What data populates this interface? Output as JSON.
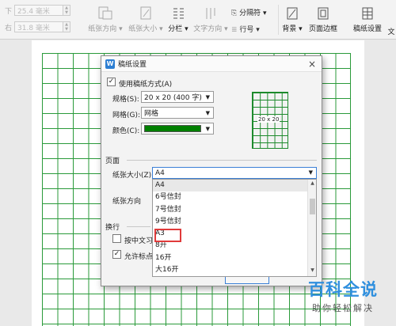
{
  "ribbon": {
    "spin1": {
      "label": "下",
      "value": "25.4 毫米"
    },
    "spin2": {
      "label": "右",
      "value": "31.8 毫米"
    },
    "buttons": [
      {
        "label": "纸张方向 ▾",
        "icon": "page-orientation-icon",
        "enabled": false
      },
      {
        "label": "纸张大小 ▾",
        "icon": "paper-size-icon",
        "enabled": false
      },
      {
        "label": "分栏 ▾",
        "icon": "columns-icon",
        "enabled": true
      },
      {
        "label": "文字方向 ▾",
        "icon": "text-direction-icon",
        "enabled": false
      },
      {
        "label": "背景 ▾",
        "icon": "background-icon",
        "enabled": true
      },
      {
        "label": "页面边框",
        "icon": "page-border-icon",
        "enabled": true
      },
      {
        "label": "稿纸设置",
        "icon": "manuscript-icon",
        "enabled": true
      },
      {
        "label": "文",
        "icon": "",
        "enabled": true
      }
    ],
    "small_buttons": {
      "separator": "分隔符 ▾",
      "line_number": "行号 ▾"
    }
  },
  "dialog": {
    "title": "稿纸设置",
    "close": "×",
    "use_manuscript": "使用稿纸方式(A)",
    "spec_label": "规格(S):",
    "spec_value": "20 x 20 (400 字)",
    "grid_label": "网格(G):",
    "grid_value": "网格",
    "color_label": "颜色(C):",
    "color_value": "#008000",
    "preview_text": "20 x 20",
    "page_section": "页面",
    "paper_size_label": "纸张大小(Z):",
    "paper_size_value": "A4",
    "orientation_label": "纸张方向",
    "wrap_section": "换行",
    "option1": "按中文习",
    "option2": "允许标点溢"
  },
  "dropdown": {
    "options": [
      "A4",
      "6号信封",
      "7号信封",
      "9号信封",
      "A3",
      "8开",
      "16开",
      "大16开"
    ],
    "selected": "A4",
    "highlighted": "A3"
  },
  "watermark": {
    "title": "百科全说",
    "subtitle": "助你轻松解决"
  },
  "colors": {
    "grid": "#2a9a3a",
    "accent": "#2f8fde",
    "highlight": "#e03a3a"
  }
}
